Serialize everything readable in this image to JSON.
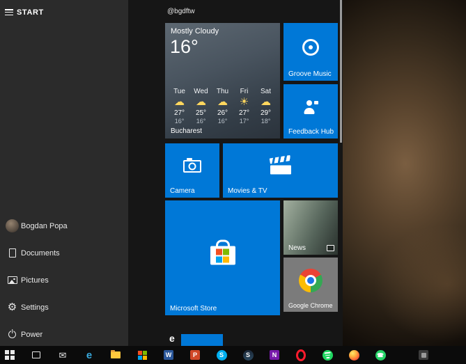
{
  "colors": {
    "accent": "#0078d7",
    "sidebar": "#2b2b2b",
    "tile_area": "#161616",
    "chrome_tile": "#7b7b7b",
    "taskbar": "#0b0b0b"
  },
  "start_menu": {
    "header": {
      "title": "START"
    },
    "account_handle": "@bgdftw",
    "sidebar_items": [
      {
        "label": "Bogdan Popa",
        "icon": "user-avatar"
      },
      {
        "label": "Documents",
        "icon": "document-icon"
      },
      {
        "label": "Pictures",
        "icon": "pictures-icon"
      },
      {
        "label": "Settings",
        "icon": "gear-icon"
      },
      {
        "label": "Power",
        "icon": "power-icon"
      }
    ],
    "tiles": {
      "weather": {
        "condition": "Mostly Cloudy",
        "temperature": "16°",
        "location": "Bucharest",
        "forecast": [
          {
            "day": "Tue",
            "glyph": "☁",
            "high": "27°",
            "low": "16°"
          },
          {
            "day": "Wed",
            "glyph": "☁",
            "high": "25°",
            "low": "16°"
          },
          {
            "day": "Thu",
            "glyph": "☁",
            "high": "26°",
            "low": "16°"
          },
          {
            "day": "Fri",
            "glyph": "☀",
            "high": "27°",
            "low": "17°"
          },
          {
            "day": "Sat",
            "glyph": "☁",
            "high": "29°",
            "low": "18°"
          }
        ]
      },
      "groove": {
        "label": "Groove Music"
      },
      "feedback": {
        "label": "Feedback Hub"
      },
      "camera": {
        "label": "Camera"
      },
      "movies": {
        "label": "Movies & TV"
      },
      "store": {
        "label": "Microsoft Store"
      },
      "news": {
        "label": "News"
      },
      "chrome": {
        "label": "Google Chrome"
      },
      "partial_edge": {
        "glyph": "e"
      }
    }
  },
  "taskbar": {
    "icons": [
      "windows-start",
      "task-view",
      "mail",
      "edge",
      "file-explorer",
      "microsoft-store",
      "word",
      "powerpoint",
      "skype",
      "steam",
      "onenote",
      "opera",
      "spotify",
      "firefox",
      "whatsapp",
      "app"
    ],
    "glyphs": {
      "mail": "✉",
      "edge": "e",
      "word": "W",
      "powerpoint": "P",
      "skype": "S",
      "steam": "S",
      "onenote": "N",
      "whatsapp": "☎"
    }
  }
}
